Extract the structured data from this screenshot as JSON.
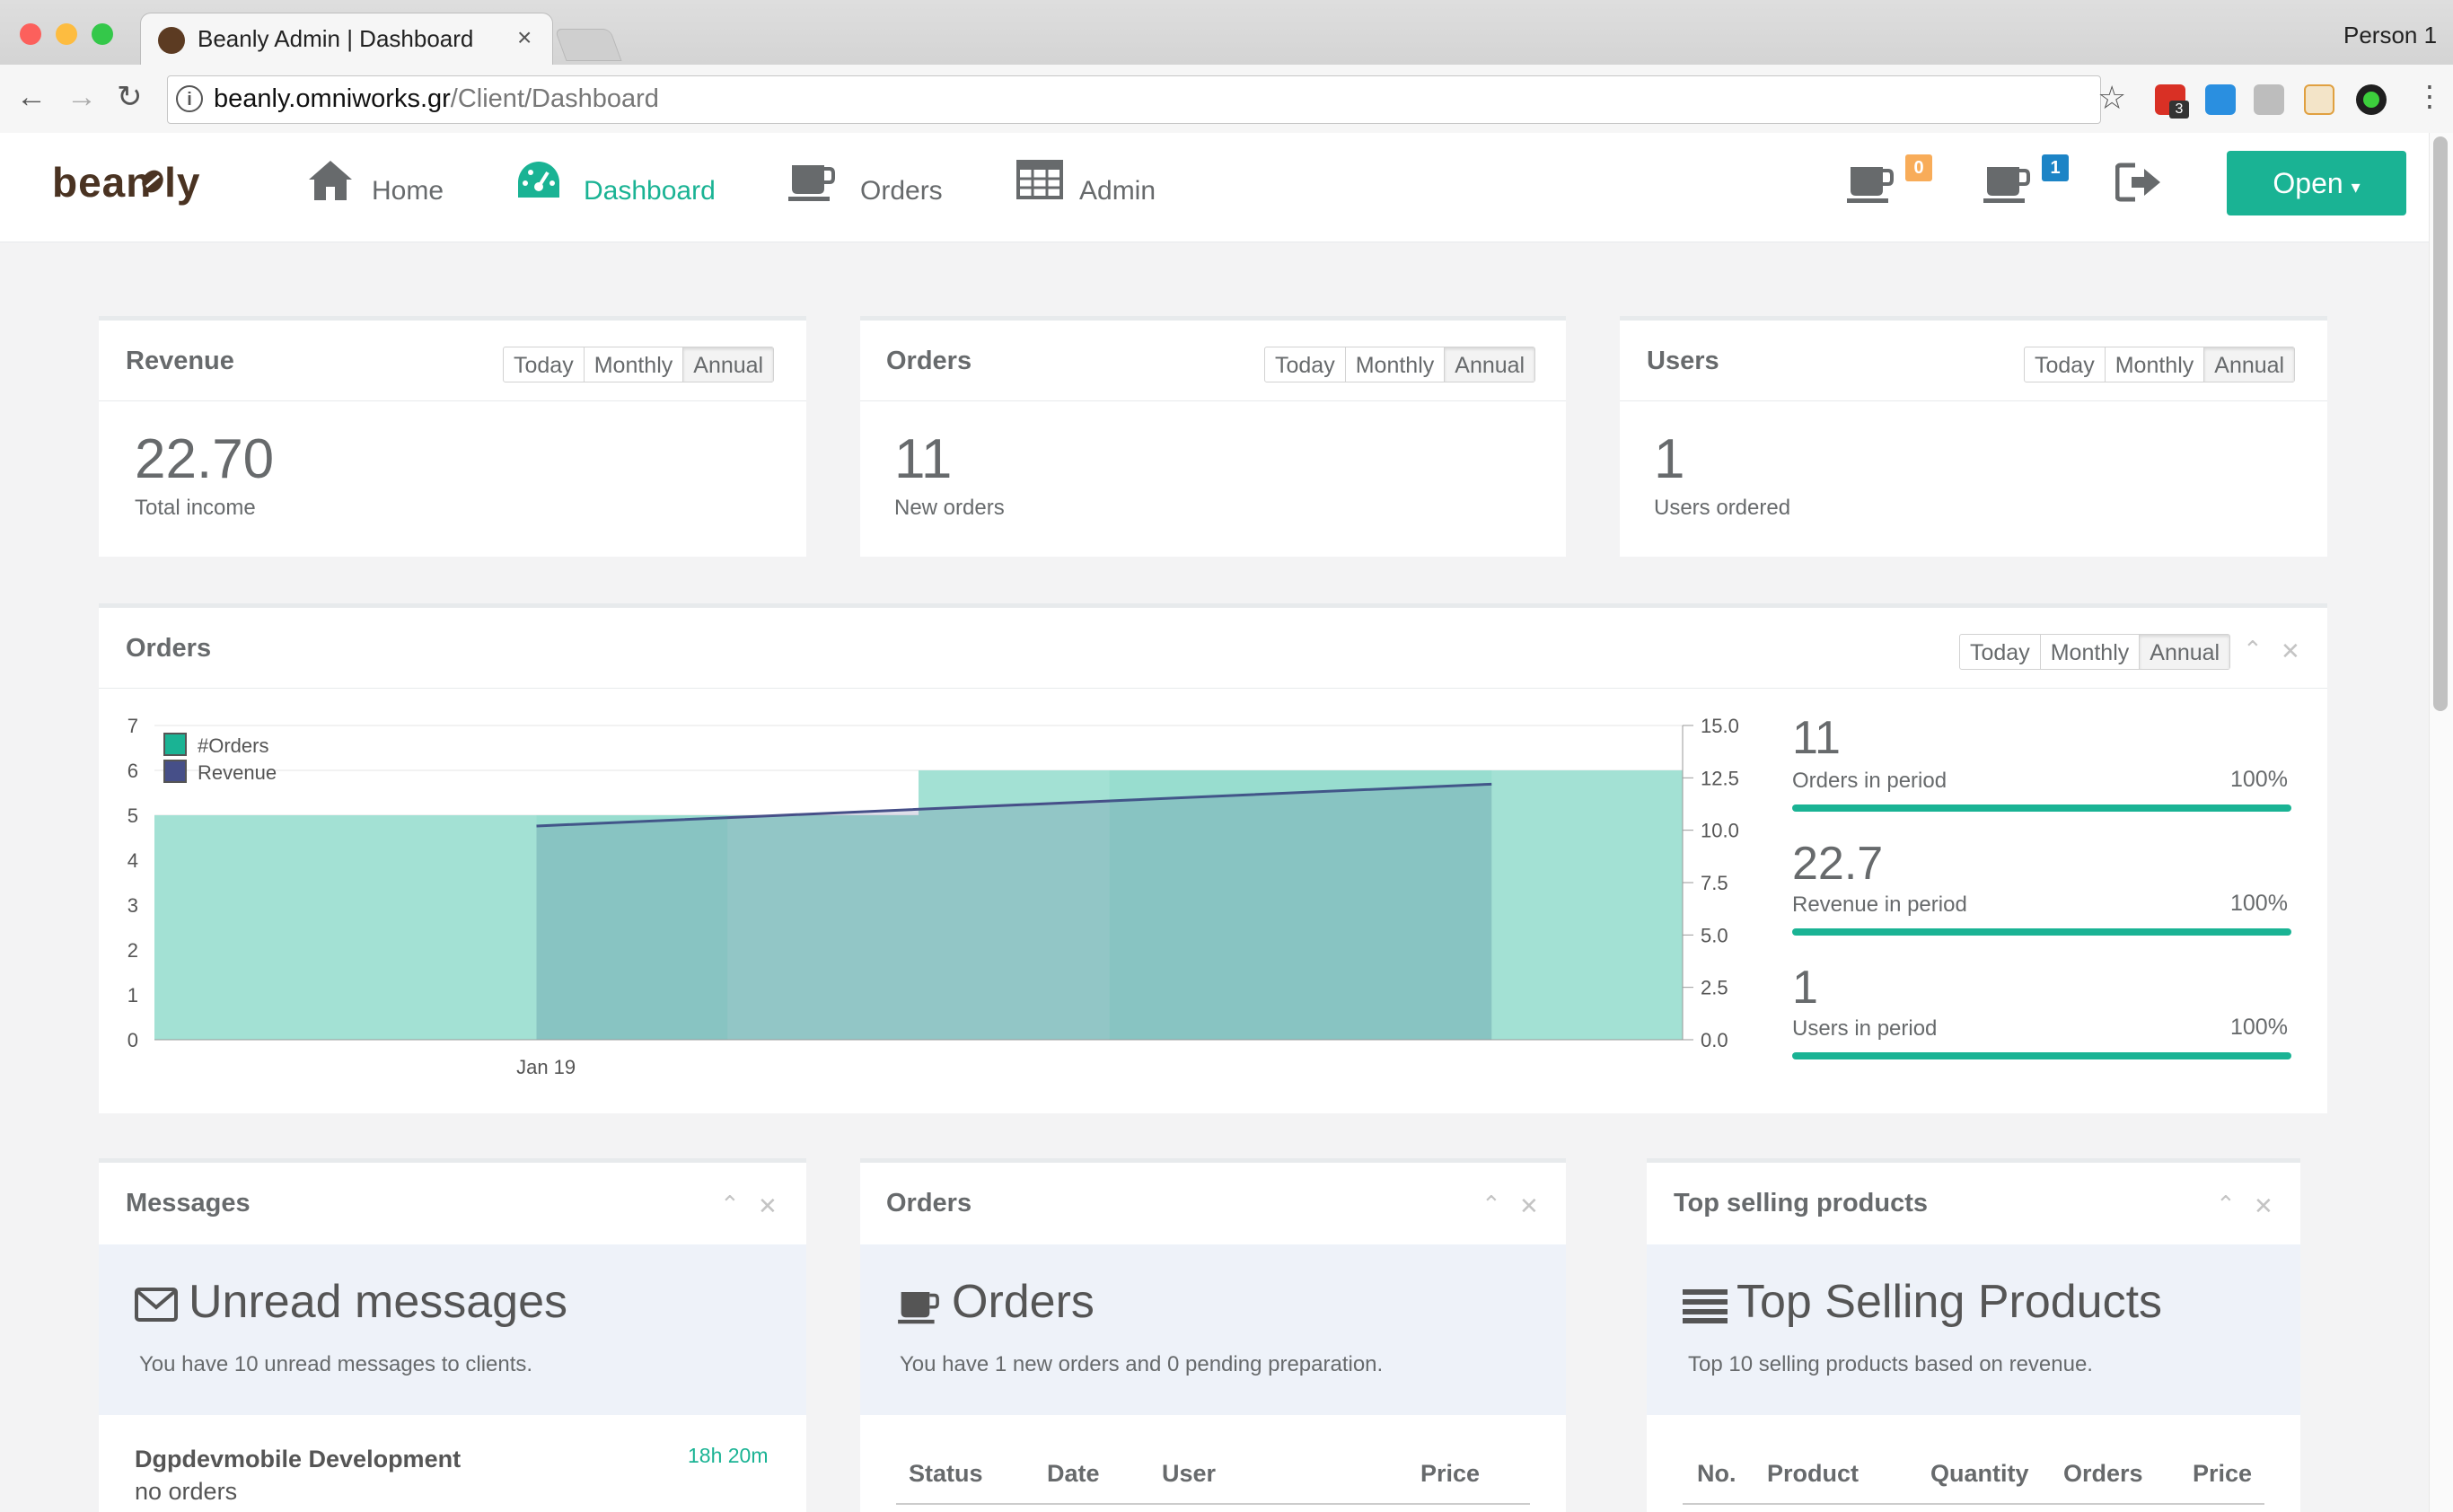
{
  "browser": {
    "tab_title": "Beanly Admin | Dashboard",
    "tab_close": "×",
    "profile": "Person 1",
    "url_host": "beanly.omniworks.gr",
    "url_path": "/Client/Dashboard",
    "back": "←",
    "forward": "→",
    "reload": "↻",
    "star": "☆",
    "menu": "⋮",
    "info": "i",
    "extension_badge": "3",
    "traffic_colors": [
      "#fc605c",
      "#fdbc40",
      "#34c84a"
    ]
  },
  "nav": {
    "logo": "bean  ly",
    "items": [
      {
        "label": "Home",
        "icon": "home-icon"
      },
      {
        "label": "Dashboard",
        "icon": "dashboard-icon"
      },
      {
        "label": "Orders",
        "icon": "coffee-cup-icon"
      },
      {
        "label": "Admin",
        "icon": "table-icon"
      }
    ],
    "badge_orange": "0",
    "badge_blue": "1",
    "open_button": "Open",
    "accent": "#1ab394"
  },
  "period_options": [
    "Today",
    "Monthly",
    "Annual"
  ],
  "stats": {
    "revenue": {
      "title": "Revenue",
      "value": "22.70",
      "caption": "Total income"
    },
    "orders": {
      "title": "Orders",
      "value": "11",
      "caption": "New orders"
    },
    "users": {
      "title": "Users",
      "value": "1",
      "caption": "Users ordered"
    }
  },
  "orders_chart_panel": {
    "title": "Orders",
    "summary": [
      {
        "value": "11",
        "label": "Orders in period",
        "percent": "100%"
      },
      {
        "value": "22.7",
        "label": "Revenue in period",
        "percent": "100%"
      },
      {
        "value": "1",
        "label": "Users in period",
        "percent": "100%"
      }
    ]
  },
  "chart_data": {
    "type": "area",
    "series": [
      {
        "name": "#Orders",
        "axis": "left",
        "color": "#1ab394",
        "steps": [
          5,
          5,
          5,
          5,
          6,
          6,
          6,
          6
        ]
      },
      {
        "name": "Revenue",
        "axis": "right",
        "color": "#464f88",
        "values": [
          10.2,
          10.7,
          11.2,
          11.7,
          12.2
        ]
      }
    ],
    "x_tick_labels": [
      "Jan 19"
    ],
    "y_left_ticks": [
      "0",
      "1",
      "2",
      "3",
      "4",
      "5",
      "6",
      "7"
    ],
    "y_right_ticks": [
      "0.0",
      "2.5",
      "5.0",
      "7.5",
      "10.0",
      "12.5",
      "15.0"
    ],
    "y_left_range": [
      0,
      7
    ],
    "y_right_range": [
      0,
      15
    ],
    "legend_position": "top-left",
    "grid": true
  },
  "messages_panel": {
    "title": "Messages",
    "heading": "Unread messages",
    "description": "You have 10 unread messages to clients.",
    "item_name": "Dgpdevmobile Development",
    "item_sub": "no orders",
    "item_time": "18h 20m"
  },
  "orders_panel": {
    "title": "Orders",
    "heading": "Orders",
    "description": "You have 1 new orders and 0 pending preparation.",
    "columns": [
      "Status",
      "Date",
      "User",
      "Price"
    ]
  },
  "top_panel": {
    "title": "Top selling products",
    "heading": "Top Selling Products",
    "description": "Top 10 selling products based on revenue.",
    "columns": [
      "No.",
      "Product",
      "Quantity",
      "Orders",
      "Price"
    ]
  },
  "tools": {
    "collapse": "⌃",
    "close": "✕"
  }
}
